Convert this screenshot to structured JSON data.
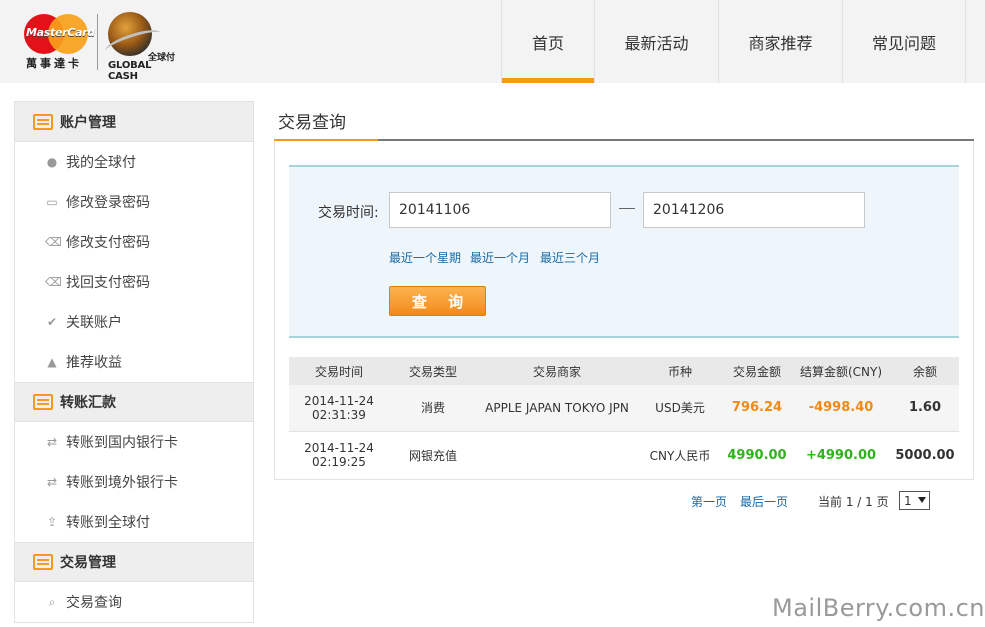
{
  "header": {
    "brand_mc": "MasterCard",
    "brand_mc_cn": "萬事達卡",
    "brand_gc_cn": "全球付",
    "brand_gc_en": "GLOBAL CASH",
    "nav": [
      {
        "label": "首页",
        "active": true
      },
      {
        "label": "最新活动"
      },
      {
        "label": "商家推荐"
      },
      {
        "label": "常见问题"
      }
    ]
  },
  "sidebar": {
    "sections": [
      {
        "title": "账户管理",
        "items": [
          "我的全球付",
          "修改登录密码",
          "修改支付密码",
          "找回支付密码",
          "关联账户",
          "推荐收益"
        ]
      },
      {
        "title": "转账汇款",
        "items": [
          "转账到国内银行卡",
          "转账到境外银行卡",
          "转账到全球付"
        ]
      },
      {
        "title": "交易管理",
        "items": [
          "交易查询"
        ]
      }
    ]
  },
  "main": {
    "title": "交易查询",
    "filter": {
      "label": "交易时间:",
      "start": "20141106",
      "end": "20141206",
      "quick": [
        "最近一个星期",
        "最近一个月",
        "最近三个月"
      ],
      "button": "查 询"
    },
    "table": {
      "headers": [
        "交易时间",
        "交易类型",
        "交易商家",
        "币种",
        "交易金额",
        "结算金额(CNY)",
        "余额"
      ],
      "rows": [
        {
          "date": "2014-11-24",
          "time": "02:31:39",
          "type": "消费",
          "merchant": "APPLE JAPAN TOKYO JPN",
          "currency": "USD美元",
          "amount": "796.24",
          "settle": "-4998.40",
          "balance": "1.60"
        },
        {
          "date": "2014-11-24",
          "time": "02:19:25",
          "type": "网银充值",
          "merchant": "",
          "currency": "CNY人民币",
          "amount": "4990.00",
          "settle": "+4990.00",
          "balance": "5000.00"
        }
      ]
    },
    "pager": {
      "first": "第一页",
      "last": "最后一页",
      "status": "当前 1 / 1 页",
      "page": "1"
    }
  },
  "watermark": "MailBerry.com.cn",
  "colors": {
    "accent": "#f49b1f",
    "link": "#1a6aa8",
    "positive": "#2fb31c",
    "negative": "#f08a14"
  }
}
